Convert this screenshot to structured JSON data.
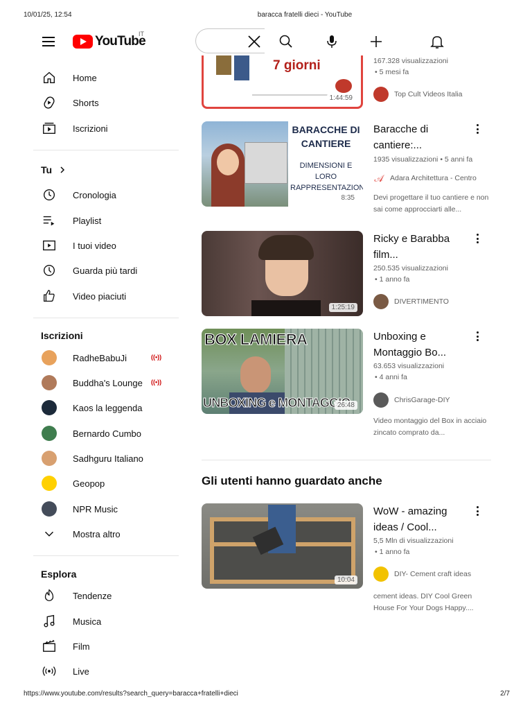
{
  "print": {
    "date": "10/01/25, 12:54",
    "title": "baracca fratelli dieci - YouTube",
    "url": "https://www.youtube.com/results?search_query=baracca+fratelli+dieci",
    "page": "2/7"
  },
  "header": {
    "logo_text": "YouTube",
    "country": "IT"
  },
  "sidebar": {
    "main": [
      {
        "label": "Home",
        "icon": "home-icon"
      },
      {
        "label": "Shorts",
        "icon": "shorts-icon"
      },
      {
        "label": "Iscrizioni",
        "icon": "subscriptions-icon"
      }
    ],
    "you_title": "Tu",
    "you": [
      {
        "label": "Cronologia",
        "icon": "history-icon"
      },
      {
        "label": "Playlist",
        "icon": "playlist-icon"
      },
      {
        "label": "I tuoi video",
        "icon": "your-videos-icon"
      },
      {
        "label": "Guarda più tardi",
        "icon": "watch-later-icon"
      },
      {
        "label": "Video piaciuti",
        "icon": "liked-videos-icon"
      }
    ],
    "subs_title": "Iscrizioni",
    "subs": [
      {
        "label": "RadheBabuJi",
        "live": "((•))",
        "color": "#e8a25c"
      },
      {
        "label": "Buddha's Lounge",
        "live": "((•))",
        "color": "#b07a5a"
      },
      {
        "label": "Kaos la leggenda",
        "color": "#1c2a3a"
      },
      {
        "label": "Bernardo Cumbo",
        "color": "#3f7d4e"
      },
      {
        "label": "Sadhguru Italiano",
        "color": "#d8a070"
      },
      {
        "label": "Geopop",
        "color": "#ffd000"
      },
      {
        "label": "NPR Music",
        "color": "#444c5a"
      }
    ],
    "show_more": "Mostra altro",
    "explore_title": "Esplora",
    "explore": [
      {
        "label": "Tendenze",
        "icon": "trending-icon"
      },
      {
        "label": "Musica",
        "icon": "music-icon"
      },
      {
        "label": "Film",
        "icon": "film-icon"
      },
      {
        "label": "Live",
        "icon": "live-icon"
      }
    ]
  },
  "videos": [
    {
      "thumb_text": "7 giorni",
      "duration": "1:44:59",
      "views": "167.328 visualizzazioni",
      "age": "• 5 mesi fa",
      "channel": "Top Cult Videos Italia"
    },
    {
      "title": "Baracche di cantiere:...",
      "thumb_text_1": "BARACCHE DI CANTIERE",
      "thumb_text_2": "DIMENSIONI E LORO RAPPRESENTAZIONE",
      "duration": "8:35",
      "views": "1935 visualizzazioni",
      "age": "• 5 anni fa",
      "channel": "Adara Architettura - Centro",
      "desc": "Devi progettare il tuo cantiere e non sai come approcciarti alle..."
    },
    {
      "title": "Ricky e Barabba film...",
      "duration": "1:25:19",
      "views": "250.535 visualizzazioni",
      "age": "• 1 anno fa",
      "channel": "DIVERTIMENTO"
    },
    {
      "title": "Unboxing e Montaggio Bo...",
      "thumb_text_1": "BOX LAMIERA",
      "thumb_text_2": "UNBOXING e MONTAGGIO",
      "duration": "26:48",
      "views": "63.653 visualizzazioni",
      "age": "• 4 anni fa",
      "channel": "ChrisGarage-DIY",
      "desc": "Video montaggio del Box in acciaio zincato comprato da..."
    }
  ],
  "also_watched": {
    "title": "Gli utenti hanno guardato anche",
    "video": {
      "title": "WoW - amazing ideas / Cool...",
      "duration": "10:04",
      "views": "5,5 Mln di visualizzazioni",
      "age": "• 1 anno fa",
      "channel": "DIY- Cement craft ideas",
      "desc": "cement ideas. DIY Cool Green House For Your Dogs Happy...."
    }
  }
}
